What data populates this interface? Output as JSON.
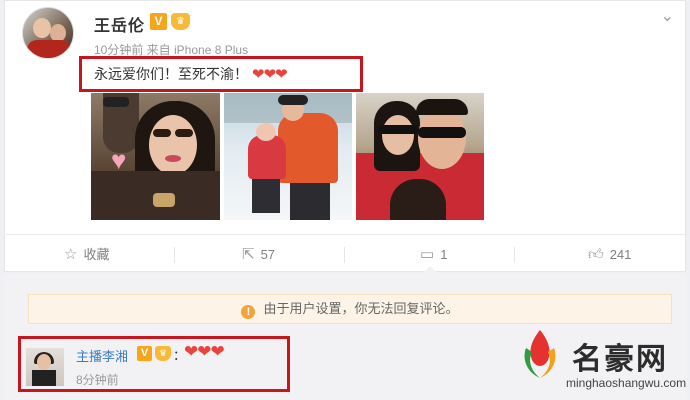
{
  "post": {
    "author": "王岳伦",
    "v_badge": "V",
    "meta": "10分钟前 来自 iPhone 8 Plus",
    "text": "永远爱你们！至死不渝！",
    "hearts": "❤❤❤",
    "chevron": "⌄"
  },
  "actions": {
    "favorite_label": "收藏",
    "repost_count": "57",
    "comment_count": "1",
    "like_count": "241"
  },
  "notice": {
    "icon": "!",
    "text": "由于用户设置，你无法回复评论。"
  },
  "comment": {
    "author": "主播李湘",
    "v_badge": "V",
    "colon": "：",
    "hearts": "❤❤❤",
    "time": "8分钟前"
  },
  "watermark": {
    "text": "名豪网",
    "url": "minghaoshangwu.com"
  },
  "colors": {
    "highlight_border": "#c8161e",
    "heart": "#e8443b",
    "link": "#3b7cc4",
    "badge": "#f7a51c"
  },
  "icons": [
    "star-icon",
    "share-icon",
    "comment-icon",
    "thumbs-up-icon",
    "warning-icon",
    "chevron-down-icon"
  ]
}
